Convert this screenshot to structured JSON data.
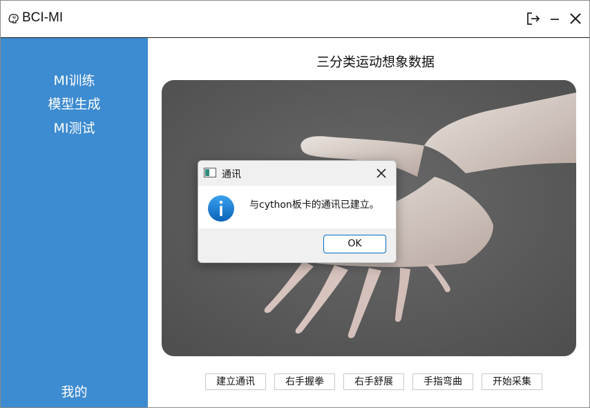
{
  "window": {
    "title": "BCI-MI"
  },
  "sidebar": {
    "items": [
      {
        "label": "MI训练"
      },
      {
        "label": "模型生成"
      },
      {
        "label": "MI测试"
      }
    ],
    "bottom_item": "我的"
  },
  "main": {
    "title": "三分类运动想象数据",
    "buttons": [
      {
        "label": "建立通讯"
      },
      {
        "label": "右手握拳"
      },
      {
        "label": "右手舒展"
      },
      {
        "label": "手指弯曲"
      },
      {
        "label": "开始采集"
      }
    ]
  },
  "dialog": {
    "title": "通讯",
    "message": "与cython板卡的通讯已建立。",
    "ok_label": "OK"
  },
  "colors": {
    "sidebar": "#3d8bd0",
    "image_background": "#6e6e6e",
    "info_icon": "#1a7fd6",
    "ok_border": "#0067c0"
  },
  "icons": {
    "app": "brain-icon",
    "logout": "logout-icon",
    "minimize": "minimize-icon",
    "close": "close-icon",
    "dialog_window": "window-icon",
    "dialog_info": "info-icon",
    "dialog_close": "close-icon"
  }
}
